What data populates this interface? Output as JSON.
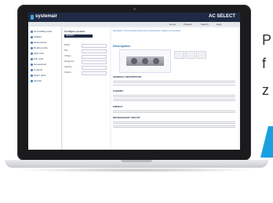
{
  "screen": {
    "brand": "systemair",
    "app_title": "AC SELECT",
    "nav": [
      "Home",
      "Projects",
      "Search",
      "Help"
    ],
    "sidebar_items": [
      "Air handling units",
      "Chillers",
      "Heat pumps",
      "Rooftop units",
      "Split units",
      "Fan coils",
      "Accessories",
      "Controls",
      "Spare parts",
      "Service"
    ],
    "form": {
      "title": "Configure product",
      "button_label": "SEARCH",
      "rows": [
        {
          "label": "Model"
        },
        {
          "label": "Size"
        },
        {
          "label": "Voltage"
        },
        {
          "label": "Refrigerant"
        },
        {
          "label": "Capacity"
        },
        {
          "label": "Options"
        }
      ]
    },
    "content": {
      "links": "Description  |  Technical data  |  Dimensions  |  Documents  |  Options  |  Accessories",
      "title": "Description",
      "sections": [
        "GENERAL DESCRIPTION",
        "CABINET",
        "ENERGY",
        "REFRIGERANT CIRCUIT"
      ]
    }
  },
  "edge_text": {
    "line1": "P",
    "line2": "f",
    "line3": "z"
  },
  "colors": {
    "brand_navy": "#1f2a44",
    "accent_blue": "#2b6fb6",
    "edge_accent": "#1aa0e0"
  }
}
